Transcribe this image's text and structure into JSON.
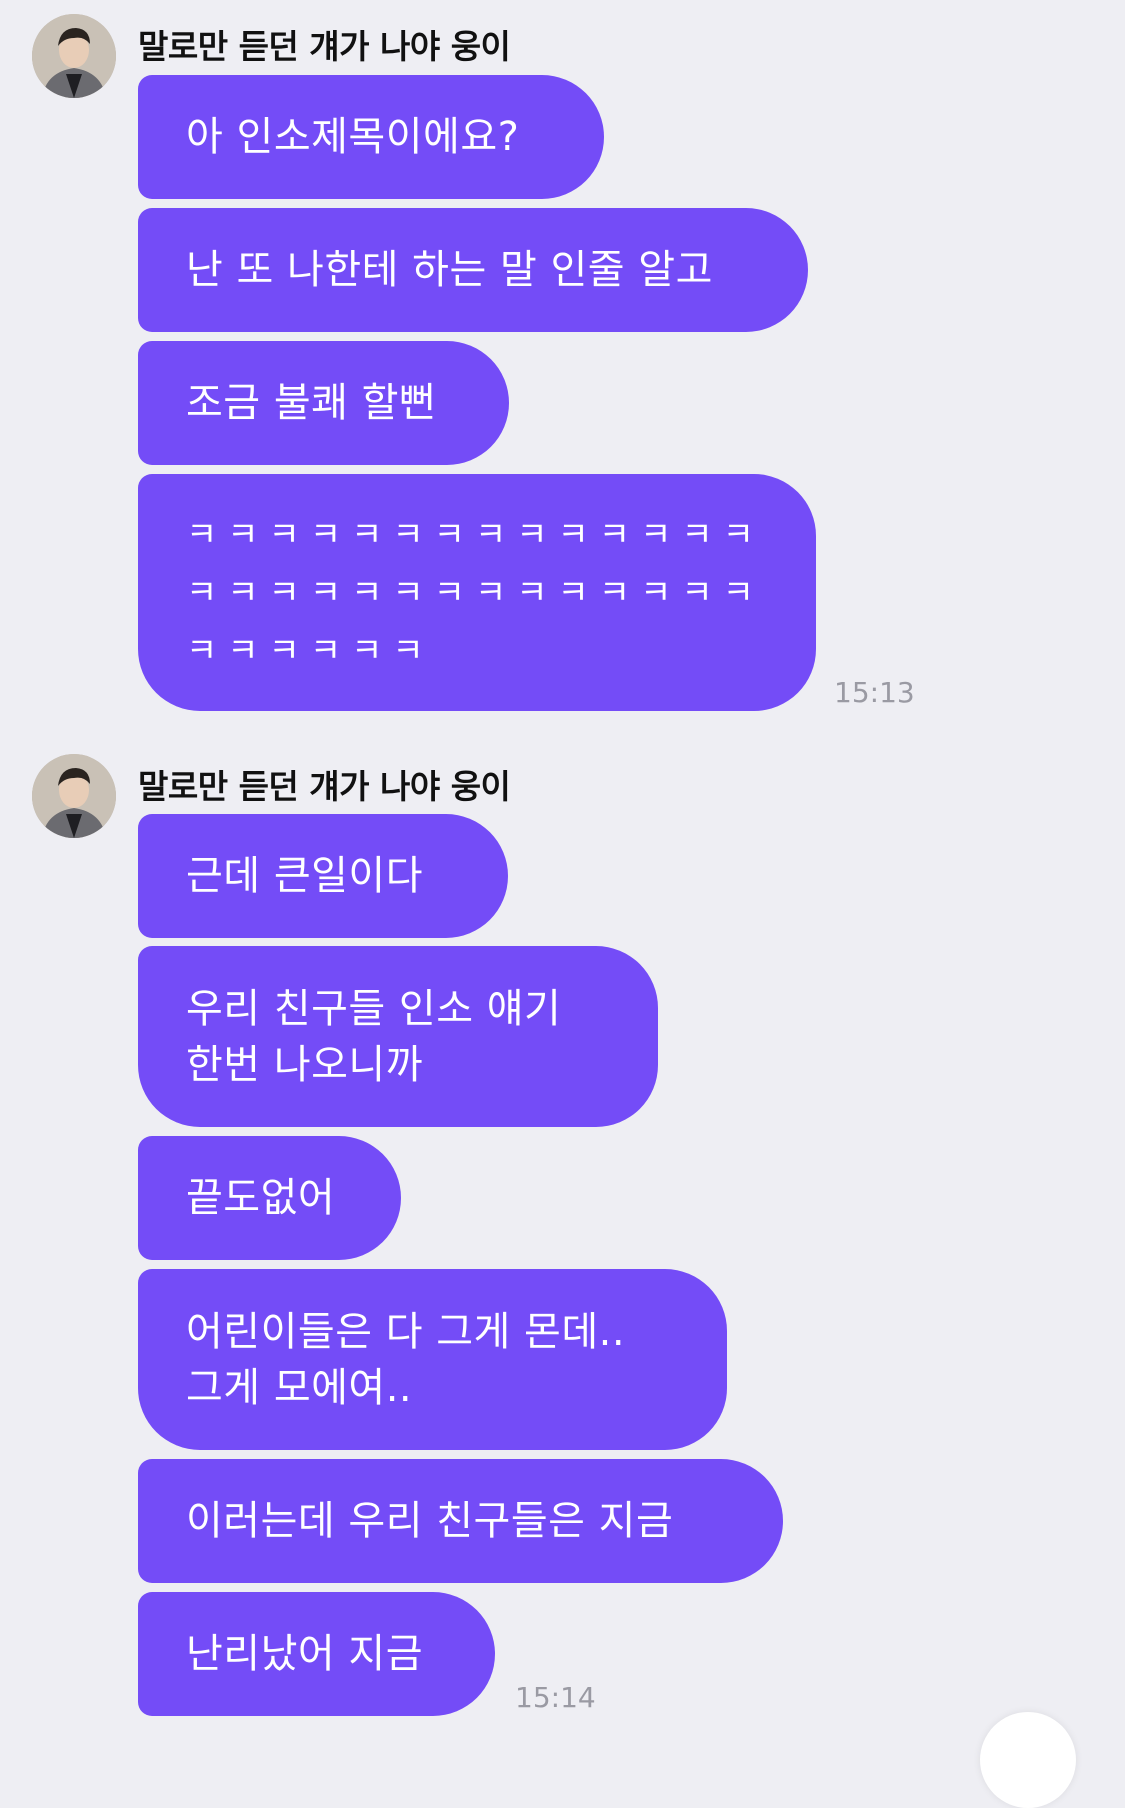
{
  "groups": [
    {
      "sender": "말로만 듣던 걔가 나야 웅이",
      "time": "15:13",
      "messages": [
        "아 인소제목이에요?",
        "난 또 나한테 하는 말 인줄 알고",
        "조금 불쾌 할뻔",
        [
          "ㅋㅋㅋㅋㅋㅋㅋㅋㅋㅋㅋㅋㅋㅋ",
          "ㅋㅋㅋㅋㅋㅋㅋㅋㅋㅋㅋㅋㅋㅋ",
          "ㅋㅋㅋㅋㅋㅋ"
        ]
      ]
    },
    {
      "sender": "말로만 듣던 걔가 나야 웅이",
      "time": "15:14",
      "messages": [
        "근데 큰일이다",
        [
          "우리 친구들 인소 얘기",
          "한번 나오니까"
        ],
        "끝도없어",
        [
          "어린이들은 다 그게 몬데..",
          "그게 모에여.."
        ],
        "이러는데 우리 친구들은 지금",
        "난리났어 지금"
      ]
    }
  ],
  "colors": {
    "background": "#eeeef3",
    "bubble": "#744cf7",
    "bubble_text": "#ffffff",
    "timestamp": "#9a9aa3"
  },
  "icons": {
    "avatar": "profile-photo"
  }
}
